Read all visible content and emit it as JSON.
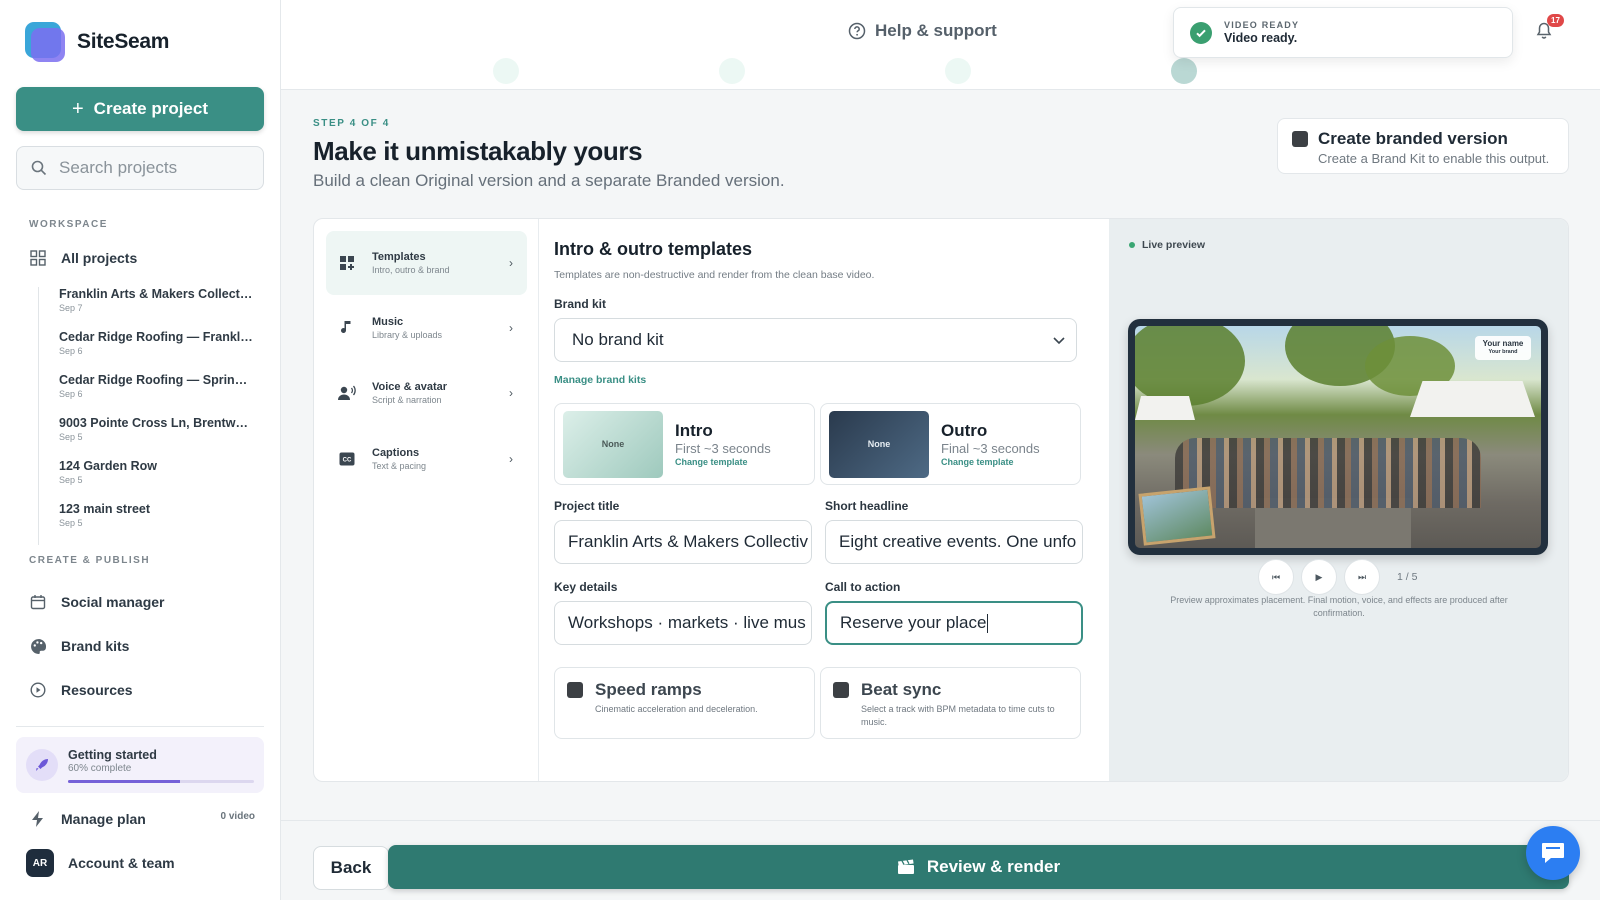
{
  "app": {
    "name": "SiteSeam",
    "brand_color": "#3a8f85"
  },
  "sidebar": {
    "create_label": "Create project",
    "search_placeholder": "Search projects",
    "workspace_label": "WORKSPACE",
    "all_projects": "All projects",
    "projects": [
      {
        "name": "Franklin Arts & Makers Collectiv...",
        "date": "Sep 7"
      },
      {
        "name": "Cedar Ridge Roofing — Franklin ...",
        "date": "Sep 6"
      },
      {
        "name": "Cedar Ridge Roofing — Spring R...",
        "date": "Sep 6"
      },
      {
        "name": "9003 Pointe Cross Ln, Brentwoo...",
        "date": "Sep 5"
      },
      {
        "name": "124 Garden Row",
        "date": "Sep 5"
      },
      {
        "name": "123 main street",
        "date": "Sep 5"
      }
    ],
    "create_publish_label": "CREATE & PUBLISH",
    "nav": {
      "social": "Social manager",
      "brand_kits": "Brand kits",
      "resources": "Resources"
    },
    "getting_started": {
      "title": "Getting started",
      "progress_text": "60% complete",
      "progress": 0.6
    },
    "manage_plan": "Manage plan",
    "plan_badge": "0 video",
    "account": {
      "initials": "AR",
      "label": "Account & team"
    }
  },
  "topbar": {
    "help": "Help & support",
    "toast": {
      "kicker": "VIDEO READY",
      "message": "Video ready."
    },
    "notifications": "17"
  },
  "main": {
    "kicker": "STEP 4 OF 4",
    "title": "Make it unmistakably yours",
    "subtitle": "Build a clean Original version and a separate Branded version.",
    "branded": {
      "title": "Create branded version",
      "subtitle": "Create a Brand Kit to enable this output."
    },
    "tabs": [
      {
        "title": "Templates",
        "subtitle": "Intro, outro & brand"
      },
      {
        "title": "Music",
        "subtitle": "Library & uploads"
      },
      {
        "title": "Voice & avatar",
        "subtitle": "Script & narration"
      },
      {
        "title": "Captions",
        "subtitle": "Text & pacing"
      }
    ],
    "form": {
      "title": "Intro & outro templates",
      "description": "Templates are non-destructive and render from the clean base video.",
      "brand_kit_label": "Brand kit",
      "brand_kit_value": "No brand kit",
      "manage_link": "Manage brand kits",
      "intro": {
        "thumb": "None",
        "name": "Intro",
        "sub": "First ~3 seconds",
        "link": "Change template"
      },
      "outro": {
        "thumb": "None",
        "name": "Outro",
        "sub": "Final ~3 seconds",
        "link": "Change template"
      },
      "project_title_label": "Project title",
      "project_title_value": "Franklin Arts & Makers Collectiv",
      "headline_label": "Short headline",
      "headline_value": "Eight creative events. One unfo",
      "details_label": "Key details",
      "details_value": "Workshops · markets · live mus",
      "cta_label": "Call to action",
      "cta_value": "Reserve your place",
      "speed": {
        "title": "Speed ramps",
        "sub": "Cinematic acceleration and deceleration."
      },
      "beat": {
        "title": "Beat sync",
        "sub": "Select a track with BPM metadata to time cuts to music."
      }
    },
    "preview": {
      "label": "Live preview",
      "chip_title": "Your name",
      "chip_sub": "Your brand",
      "counter": "1 / 5",
      "note": "Preview approximates placement. Final motion, voice, and effects are produced after confirmation."
    }
  },
  "footer": {
    "back": "Back",
    "render": "Review & render"
  }
}
